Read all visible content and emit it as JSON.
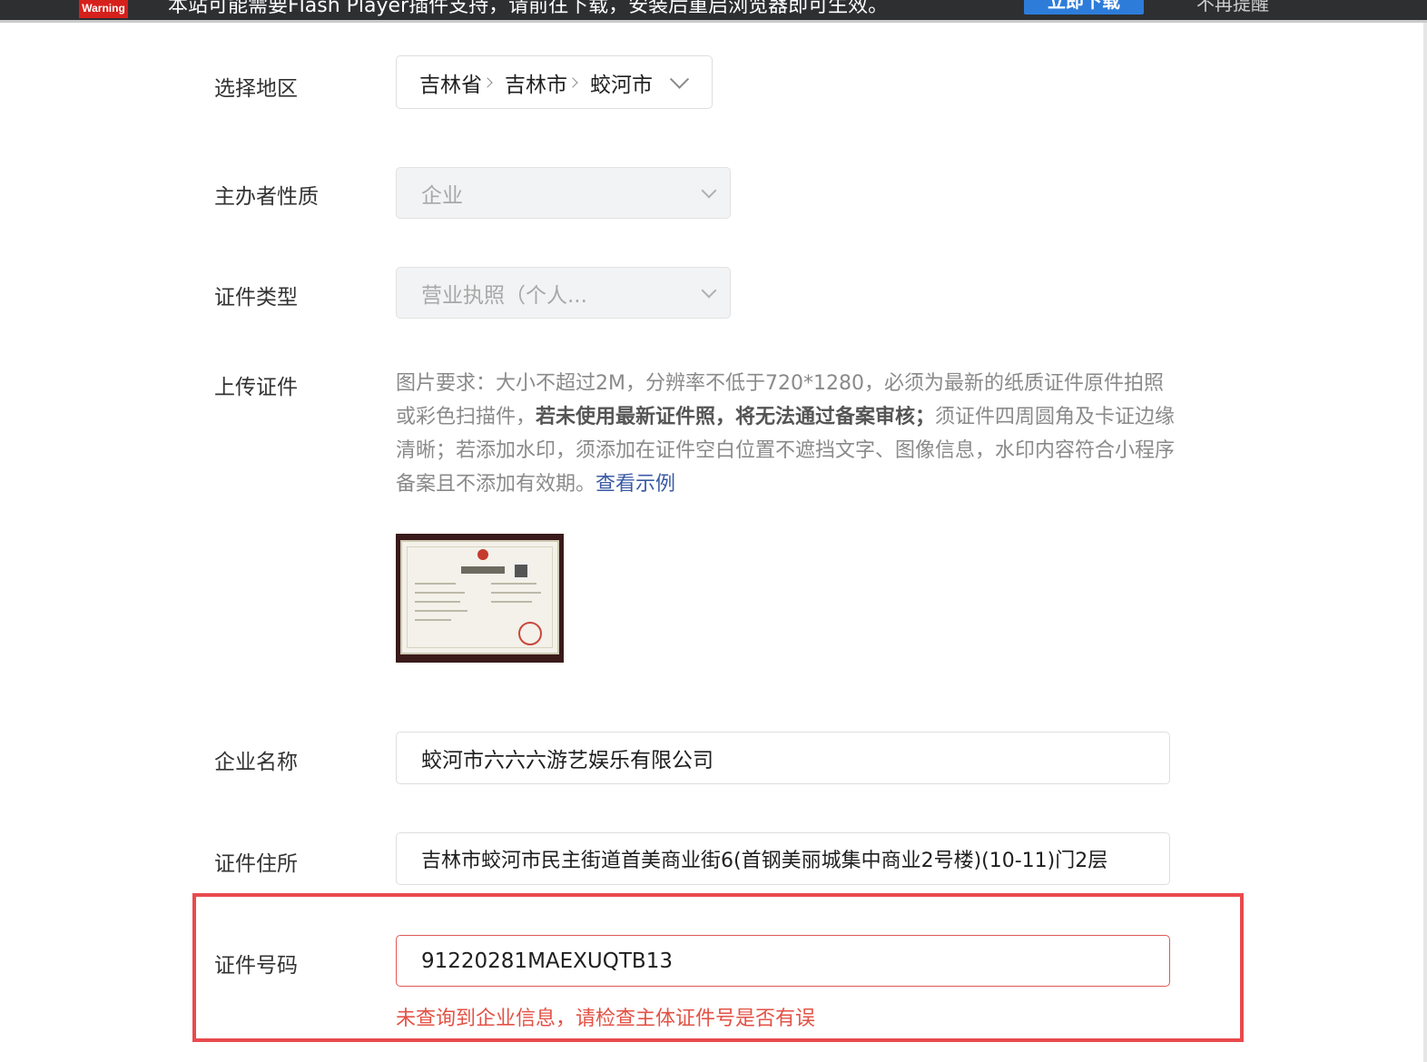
{
  "notification_bar": {
    "badge": "Warning",
    "message": "本站可能需要Flash Player插件支持，请前往下载，安装后重启浏览器即可生效。",
    "download_button": "立即下载",
    "dismiss": "不再提醒"
  },
  "form": {
    "region": {
      "label": "选择地区",
      "province": "吉林省",
      "city": "吉林市",
      "district": "蛟河市"
    },
    "organizer_type": {
      "label": "主办者性质",
      "value": "企业"
    },
    "certificate_type": {
      "label": "证件类型",
      "value": "营业执照（个人..."
    },
    "upload": {
      "label": "上传证件",
      "requirement_prefix": "图片要求：大小不超过2M，分辨率不低于720*1280，必须为最新的纸质证件原件拍照或彩色扫描件，",
      "requirement_bold": "若未使用最新证件照，将无法通过备案审核；",
      "requirement_suffix": "须证件四周圆角及卡证边缘清晰；若添加水印，须添加在证件空白位置不遮挡文字、图像信息，水印内容符合小程序备案且不添加有效期。",
      "example_link": "查看示例"
    },
    "company_name": {
      "label": "企业名称",
      "value": "蛟河市六六六游艺娱乐有限公司"
    },
    "certificate_address": {
      "label": "证件住所",
      "value": "吉林市蛟河市民主街道首美商业街6(首钢美丽城集中商业2号楼)(10-11)门2层"
    },
    "certificate_number": {
      "label": "证件号码",
      "value": "91220281MAEXUQTB13",
      "error": "未查询到企业信息，请检查主体证件号是否有误"
    }
  }
}
